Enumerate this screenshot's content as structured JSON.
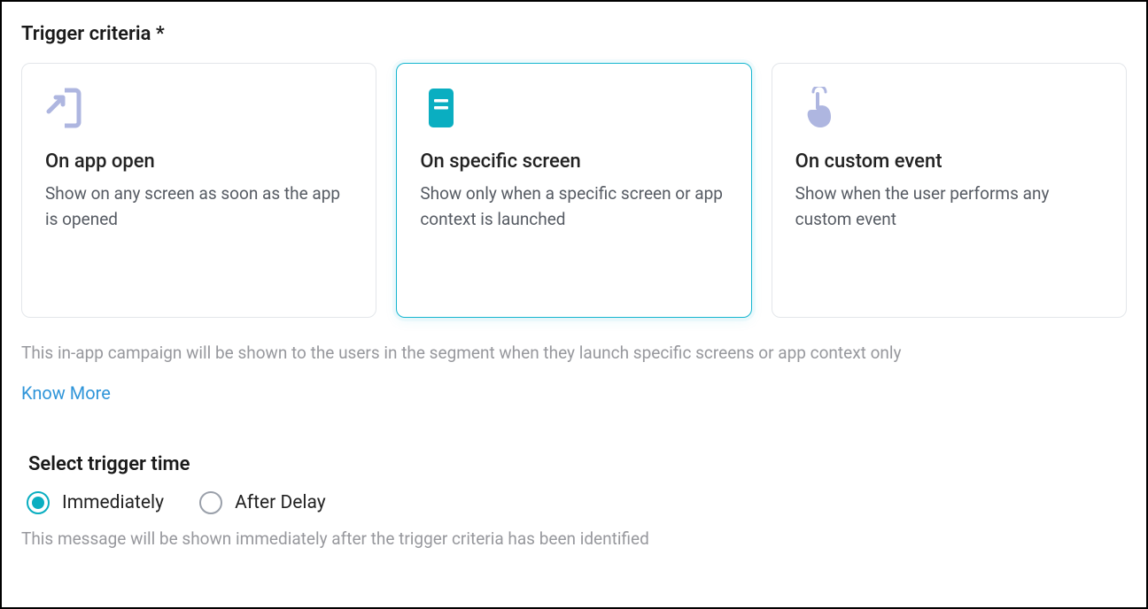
{
  "section_title": "Trigger criteria *",
  "cards": {
    "app_open": {
      "title": "On app open",
      "desc": "Show on any screen as soon as the app is opened",
      "selected": false
    },
    "specific_screen": {
      "title": "On specific screen",
      "desc": "Show only when a specific screen or app context is launched",
      "selected": true
    },
    "custom_event": {
      "title": "On custom event",
      "desc": "Show when the user performs any custom event",
      "selected": false
    }
  },
  "hint": "This in-app campaign will be shown to the users in the segment when they launch specific screens or app context only",
  "know_more": "Know More",
  "trigger_time": {
    "title": "Select trigger time",
    "options": {
      "immediately": {
        "label": "Immediately",
        "checked": true
      },
      "after_delay": {
        "label": "After Delay",
        "checked": false
      }
    },
    "hint": "This message will be shown immediately after the trigger criteria has been identified"
  }
}
